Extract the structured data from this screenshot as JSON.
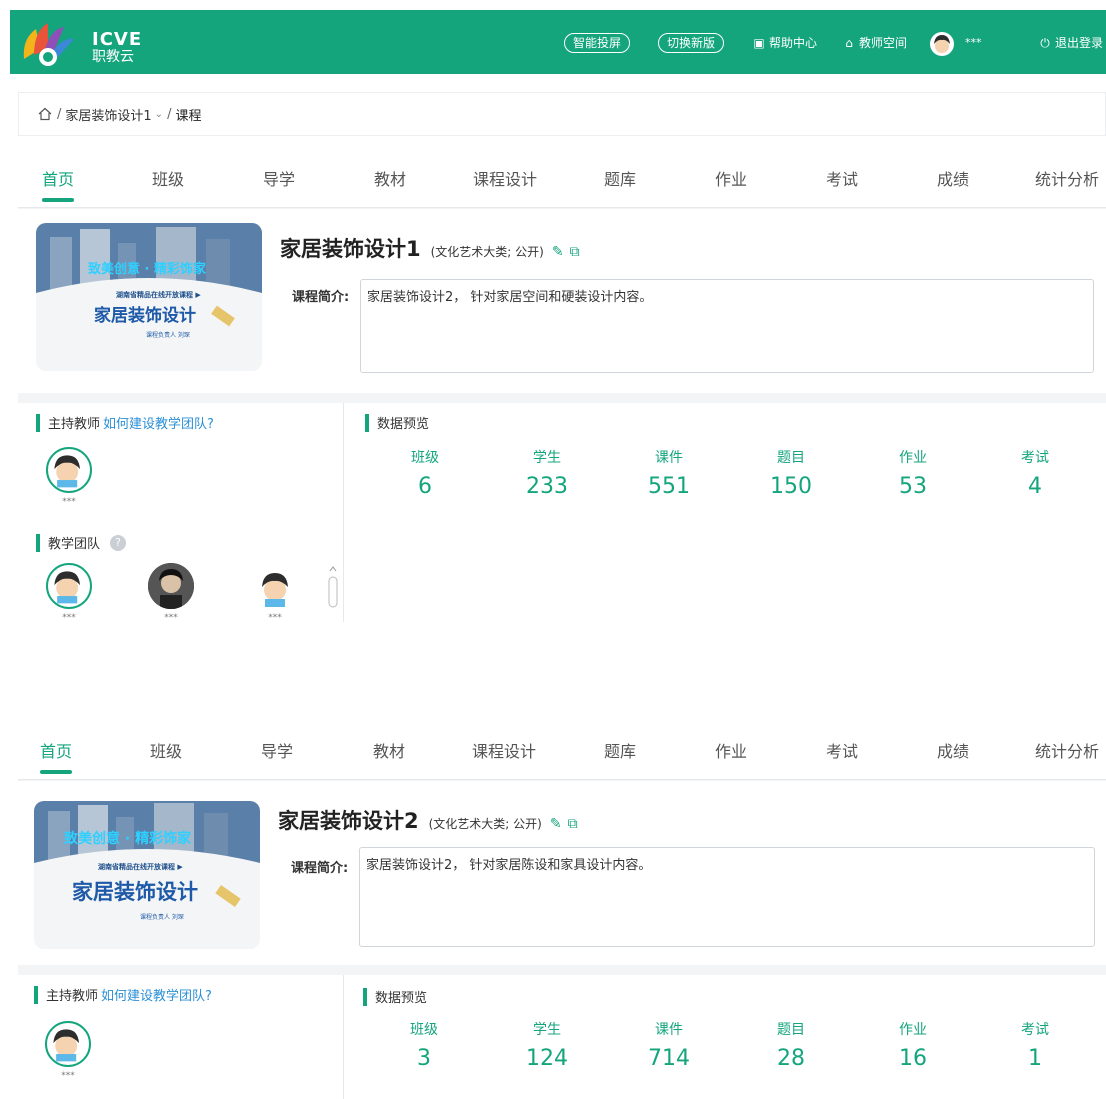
{
  "header": {
    "logo_text": "ICVE",
    "logo_sub": "职教云",
    "pill_1": "智能投屏",
    "pill_2": "切换新版",
    "help": "帮助中心",
    "teacher_space": "教师空间",
    "user_name": "***",
    "logout": "退出登录"
  },
  "breadcrumb": {
    "course": "家居装饰设计1",
    "current": "课程"
  },
  "tabs": [
    "首页",
    "班级",
    "导学",
    "教材",
    "课程设计",
    "题库",
    "作业",
    "考试",
    "成绩",
    "统计分析"
  ],
  "courses": [
    {
      "title": "家居装饰设计1",
      "category": "(文化艺术大类; 公开)",
      "desc_label": "课程简介:",
      "desc": "家居装饰设计2， 针对家居空间和硬装设计内容。",
      "cover": {
        "top": "致美创意 · 精彩饰家",
        "mid": "湖南省精品在线开放课程 ▶",
        "main": "家居装饰设计",
        "sub": "课程负责人  刘琛"
      },
      "host_heading": "主持教师",
      "host_link": "如何建设教学团队?",
      "host_name": "***",
      "team_heading": "教学团队",
      "team_names": [
        "***",
        "***",
        "***"
      ],
      "stats_heading": "数据预览",
      "stats": [
        {
          "label": "班级",
          "value": "6"
        },
        {
          "label": "学生",
          "value": "233"
        },
        {
          "label": "课件",
          "value": "551"
        },
        {
          "label": "题目",
          "value": "150"
        },
        {
          "label": "作业",
          "value": "53"
        },
        {
          "label": "考试",
          "value": "4"
        }
      ]
    },
    {
      "title": "家居装饰设计2",
      "category": "(文化艺术大类; 公开)",
      "desc_label": "课程简介:",
      "desc": "家居装饰设计2， 针对家居陈设和家具设计内容。",
      "cover": {
        "top": "致美创意 · 精彩饰家",
        "mid": "湖南省精品在线开放课程 ▶",
        "main": "家居装饰设计",
        "sub": "课程负责人  刘琛"
      },
      "host_heading": "主持教师",
      "host_link": "如何建设教学团队?",
      "host_name": "***",
      "stats_heading": "数据预览",
      "stats": [
        {
          "label": "班级",
          "value": "3"
        },
        {
          "label": "学生",
          "value": "124"
        },
        {
          "label": "课件",
          "value": "714"
        },
        {
          "label": "题目",
          "value": "28"
        },
        {
          "label": "作业",
          "value": "16"
        },
        {
          "label": "考试",
          "value": "1"
        }
      ]
    }
  ],
  "colors": {
    "accent": "#14a57d",
    "link": "#2b8fd6"
  }
}
